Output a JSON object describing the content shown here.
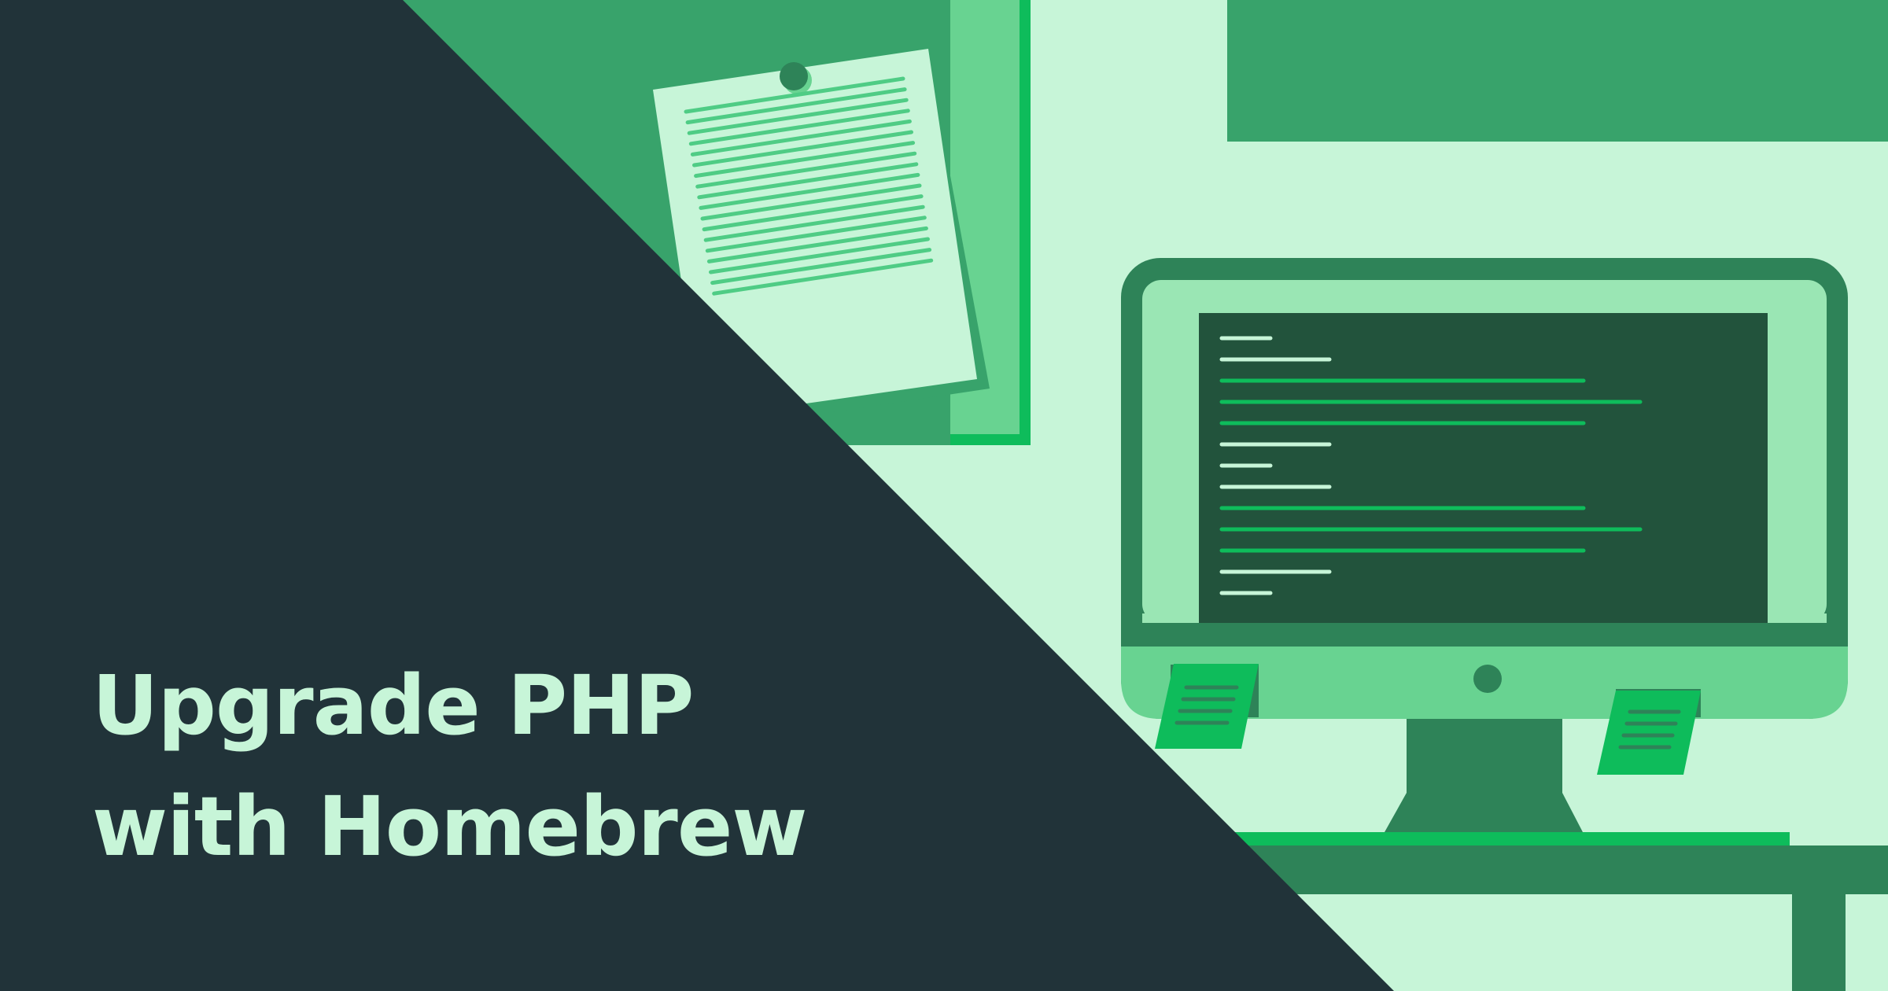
{
  "headline": {
    "line1": "Upgrade PHP",
    "line2": "with Homebrew"
  },
  "colors": {
    "background": "#c7f5d8",
    "dark_panel": "#213339",
    "green_block": "#38a36b",
    "green_medium": "#68d391",
    "green_bright": "#0ebc5b",
    "green_dark": "#2e8358",
    "screen_bg": "#22533c",
    "text_light": "#c7f5d8"
  },
  "icons": [
    "clipboard-icon",
    "monitor-icon",
    "sticky-note-icon"
  ]
}
